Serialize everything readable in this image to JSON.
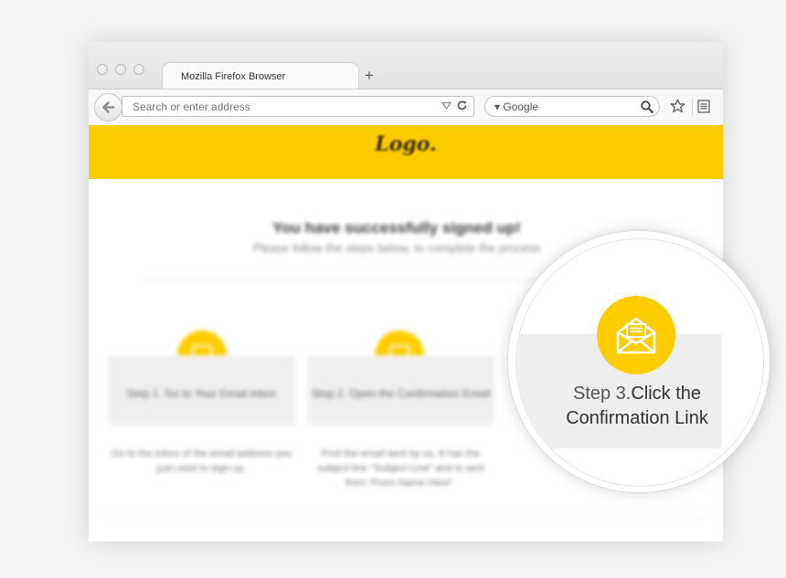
{
  "browser": {
    "tab_title": "Mozilla Firefox Browser",
    "address_placeholder": "Search or enter address",
    "search_engine": "Google"
  },
  "page": {
    "logo": "Logo.",
    "title": "You have successfully signed up!",
    "subtitle": "Please follow the steps below, to complete the process",
    "steps": [
      {
        "label": "Step 1. Go to Your Email inbox",
        "description": "Go to the inbox of the email address you just used to sign up."
      },
      {
        "label": "Step 2. Open the Confirmation Email",
        "description": "Find the email sent by us. It has the subject line \"Subject Line\" and is sent from \"From Name Here\"."
      }
    ],
    "step3": {
      "prefix": "Step 3.",
      "line1": "Click the",
      "line2": "Confirmation Link"
    }
  },
  "colors": {
    "accent": "#ffcc00",
    "icon_fg": "#ffffff"
  }
}
